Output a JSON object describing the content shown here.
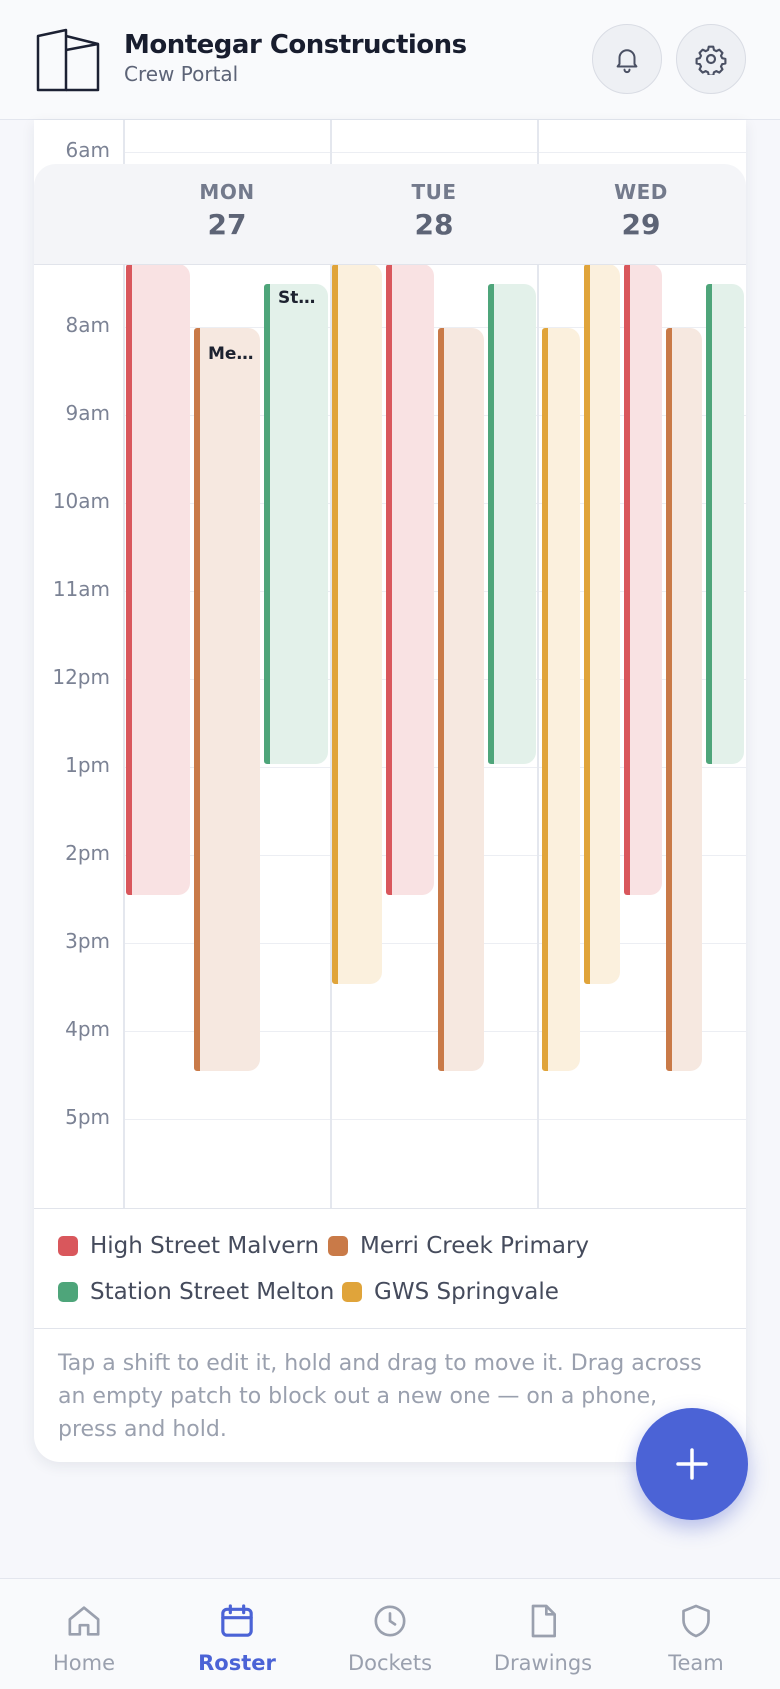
{
  "header": {
    "title": "Montegar Constructions",
    "subtitle": "Crew Portal",
    "notifications_icon": "bell-icon",
    "settings_icon": "gear-icon"
  },
  "calendar": {
    "hours": [
      "6am",
      "8am",
      "9am",
      "10am",
      "11am",
      "12pm",
      "1pm",
      "2pm",
      "3pm",
      "4pm",
      "5pm"
    ],
    "days": [
      {
        "name": "MON",
        "date": "27"
      },
      {
        "name": "TUE",
        "date": "28"
      },
      {
        "name": "WED",
        "date": "29"
      }
    ],
    "shifts": [
      {
        "day": "MON",
        "site": "High Street Malvern",
        "label": "",
        "start": "6:00",
        "end": "2:30pm"
      },
      {
        "day": "MON",
        "site": "Merri Creek Primary",
        "label": "Me…",
        "start": "8:00am",
        "end": "4:30pm"
      },
      {
        "day": "MON",
        "site": "Station Street Melton",
        "label": "St…",
        "start": "7:30am",
        "end": "1:00pm"
      },
      {
        "day": "TUE",
        "site": "GWS Springvale",
        "label": "",
        "start": "6:00",
        "end": "3:30pm"
      },
      {
        "day": "TUE",
        "site": "High Street Malvern",
        "label": "",
        "start": "6:00",
        "end": "2:30pm"
      },
      {
        "day": "TUE",
        "site": "Merri Creek Primary",
        "label": "",
        "start": "8:00am",
        "end": "4:30pm"
      },
      {
        "day": "TUE",
        "site": "Station Street Melton",
        "label": "",
        "start": "7:30am",
        "end": "1:00pm"
      },
      {
        "day": "WED",
        "site": "GWS Springvale",
        "label": "",
        "start": "8:00am",
        "end": "4:30pm"
      },
      {
        "day": "WED",
        "site": "GWS Springvale",
        "label": "",
        "start": "6:00",
        "end": "3:30pm"
      },
      {
        "day": "WED",
        "site": "High Street Malvern",
        "label": "",
        "start": "6:00",
        "end": "2:30pm"
      },
      {
        "day": "WED",
        "site": "Merri Creek Primary",
        "label": "",
        "start": "8:00am",
        "end": "4:30pm"
      },
      {
        "day": "WED",
        "site": "Station Street Melton",
        "label": "",
        "start": "7:30am",
        "end": "1:00pm"
      }
    ]
  },
  "legend": [
    {
      "label": "High Street Malvern",
      "color": "#d9575c"
    },
    {
      "label": "Merri Creek Primary",
      "color": "#c97a48"
    },
    {
      "label": "Station Street Melton",
      "color": "#4ea57a"
    },
    {
      "label": "GWS Springvale",
      "color": "#e0a43a"
    }
  ],
  "hint": "Tap a shift to edit it, hold and drag to move it. Drag across an empty patch to block out a new one — on a phone, press and hold.",
  "fab_icon": "plus-icon",
  "nav": [
    {
      "label": "Home",
      "icon": "home-icon",
      "active": false
    },
    {
      "label": "Roster",
      "icon": "calendar-icon",
      "active": true
    },
    {
      "label": "Dockets",
      "icon": "clock-icon",
      "active": false
    },
    {
      "label": "Drawings",
      "icon": "document-icon",
      "active": false
    },
    {
      "label": "Team",
      "icon": "shield-icon",
      "active": false
    }
  ],
  "colors": {
    "accent": "#4b63d6",
    "high_street_malvern": "#d9575c",
    "merri_creek_primary": "#c97a48",
    "station_street_melton": "#4ea57a",
    "gws_springvale": "#e0a43a"
  }
}
